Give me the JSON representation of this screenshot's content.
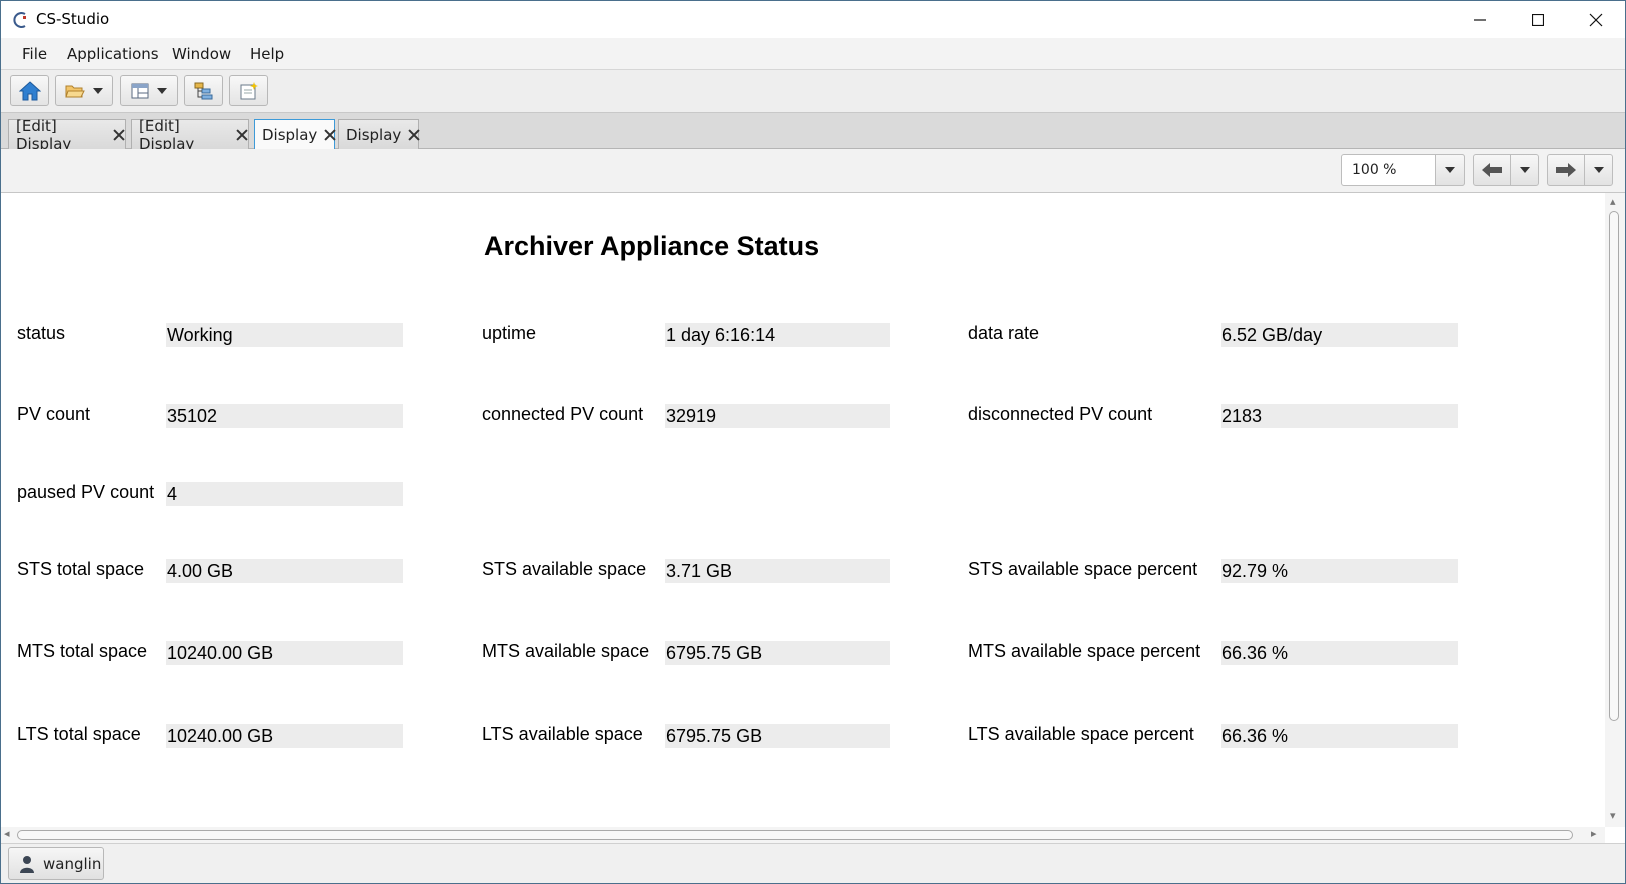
{
  "window": {
    "title": "CS-Studio"
  },
  "menu": {
    "items": [
      "File",
      "Applications",
      "Window",
      "Help"
    ]
  },
  "toolbar": {
    "buttons": [
      "home-icon",
      "open-folder-icon",
      "layout-icon",
      "tree-icon",
      "new-display-icon"
    ]
  },
  "tabs": [
    {
      "label": "[Edit] Display",
      "active": false
    },
    {
      "label": "[Edit] Display",
      "active": false
    },
    {
      "label": "Display",
      "active": true
    },
    {
      "label": "Display",
      "active": false
    }
  ],
  "display_toolbar": {
    "zoom": "100 %"
  },
  "display": {
    "title": "Archiver Appliance Status",
    "fields": {
      "status": {
        "label": "status",
        "value": "Working"
      },
      "uptime": {
        "label": "uptime",
        "value": "1 day 6:16:14"
      },
      "data_rate": {
        "label": "data rate",
        "value": "6.52 GB/day"
      },
      "pv_count": {
        "label": "PV count",
        "value": "35102"
      },
      "connected_pv_count": {
        "label": "connected PV count",
        "value": "32919"
      },
      "disconnected_pv_count": {
        "label": "disconnected PV count",
        "value": "2183"
      },
      "paused_pv_count": {
        "label": "paused PV count",
        "value": "4"
      },
      "sts_total_space": {
        "label": "STS total space",
        "value": "4.00 GB"
      },
      "sts_available_space": {
        "label": "STS available space",
        "value": "3.71 GB"
      },
      "sts_available_space_percent": {
        "label": "STS available space percent",
        "value": "92.79 %"
      },
      "mts_total_space": {
        "label": "MTS total space",
        "value": "10240.00 GB"
      },
      "mts_available_space": {
        "label": "MTS available space",
        "value": "6795.75 GB"
      },
      "mts_available_space_percent": {
        "label": "MTS available space percent",
        "value": "66.36 %"
      },
      "lts_total_space": {
        "label": "LTS total space",
        "value": "10240.00 GB"
      },
      "lts_available_space": {
        "label": "LTS available space",
        "value": "6795.75 GB"
      },
      "lts_available_space_percent": {
        "label": "LTS available space percent",
        "value": "66.36 %"
      }
    }
  },
  "statusbar": {
    "user": "wanglin"
  }
}
